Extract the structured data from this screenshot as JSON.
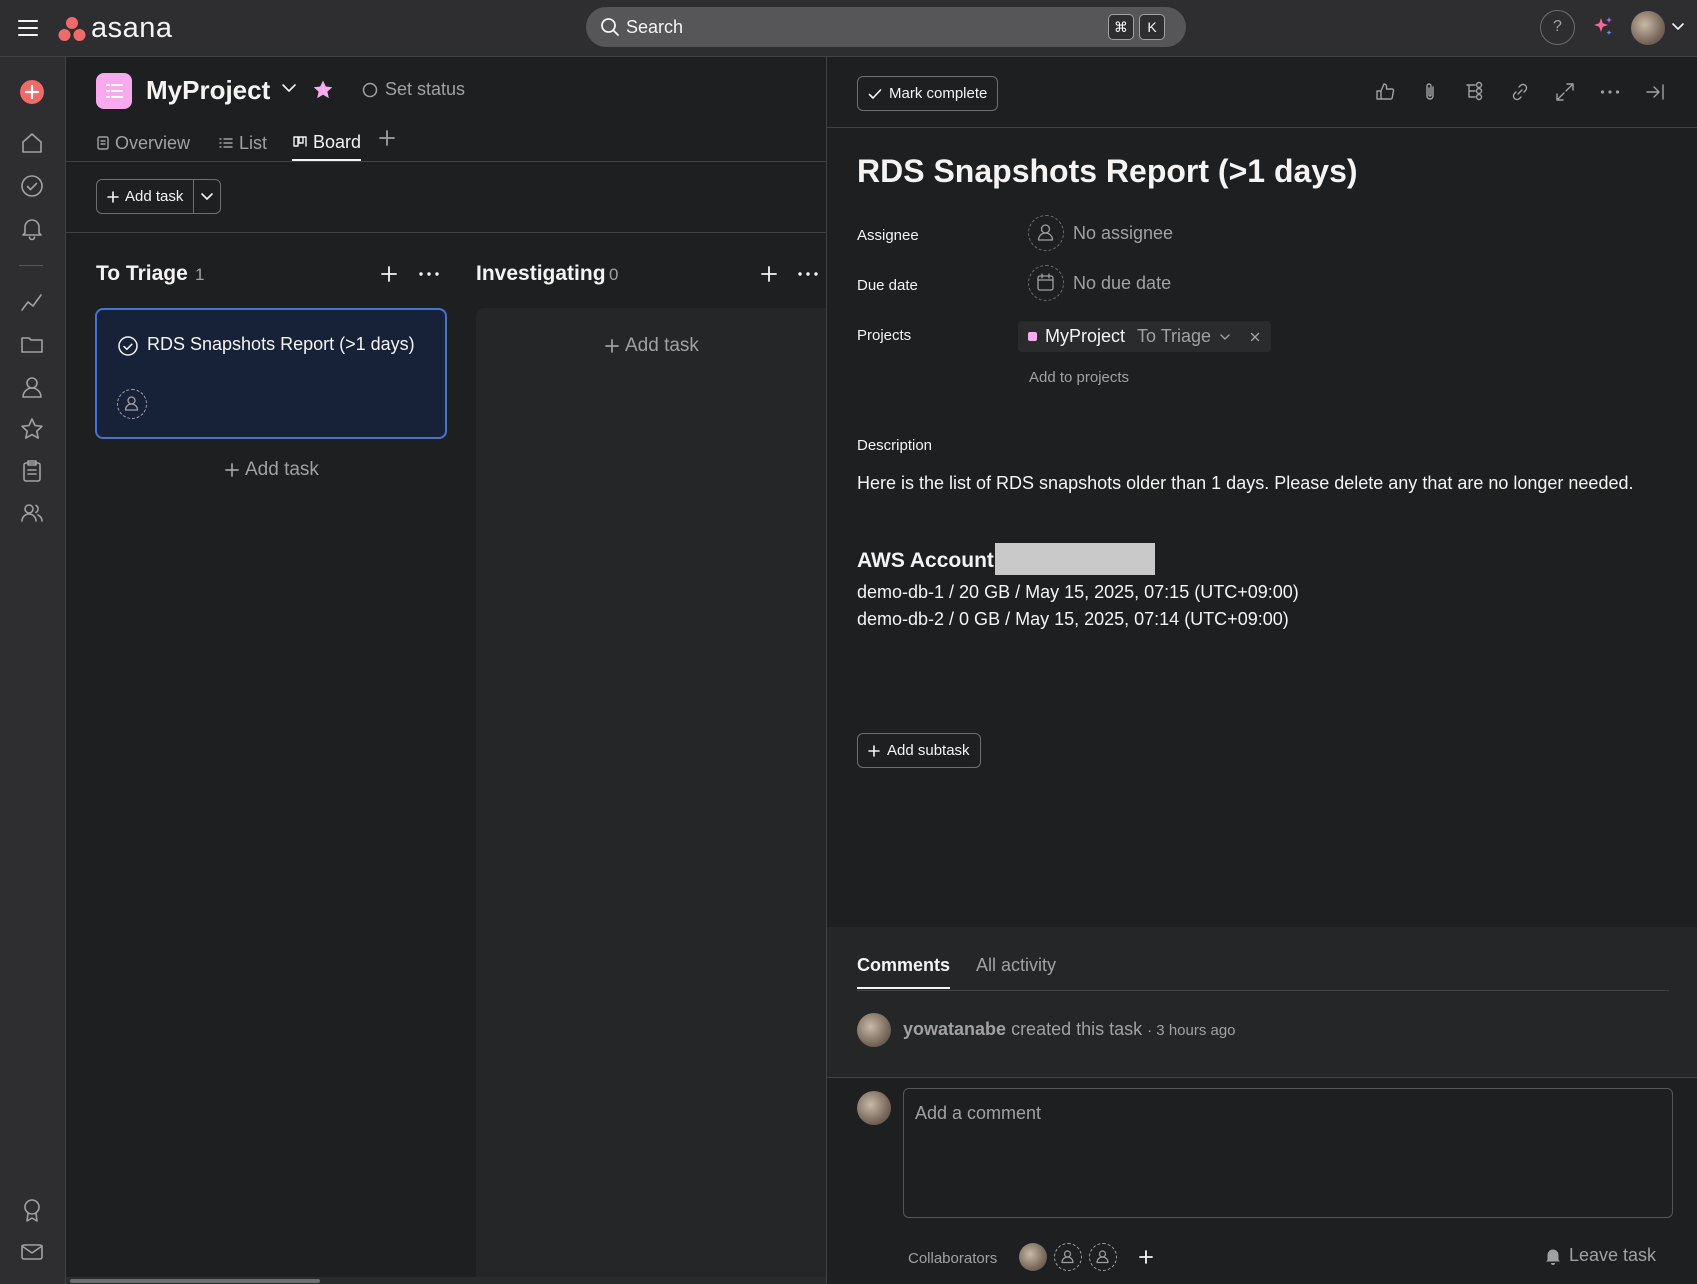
{
  "app": {
    "logo_text": "asana",
    "search_label": "Search",
    "search_keys": [
      "⌘",
      "K"
    ],
    "help_label": "?",
    "accent_color": "#f06a6a",
    "icons": {
      "menu": "hamburger-icon",
      "ai": "sparkle-icon",
      "rail": [
        "create-plus-icon",
        "home-icon",
        "my-tasks-icon",
        "inbox-bell-icon",
        "reporting-icon",
        "portfolios-folder-icon",
        "goals-person-icon",
        "favorites-star-icon",
        "projects-clipboard-icon",
        "teams-people-icon",
        "invite-badge-icon",
        "mail-icon"
      ]
    }
  },
  "project": {
    "name": "MyProject",
    "color": "#f9aaef",
    "set_status_label": "Set status",
    "tabs": [
      {
        "label": "Overview",
        "active": false
      },
      {
        "label": "List",
        "active": false
      },
      {
        "label": "Board",
        "active": true
      }
    ],
    "add_task_label": "Add task"
  },
  "board": {
    "columns": [
      {
        "title": "To Triage",
        "count": "1",
        "cards": [
          {
            "title": "RDS Snapshots Report (>1 days)"
          }
        ],
        "add_task_label": "Add task"
      },
      {
        "title": "Investigating",
        "count": "0",
        "cards": [],
        "add_task_label": "Add task"
      }
    ]
  },
  "task": {
    "mark_complete_label": "Mark complete",
    "title": "RDS Snapshots Report (>1 days)",
    "fields": {
      "assignee_label": "Assignee",
      "assignee_value": "No assignee",
      "due_label": "Due date",
      "due_value": "No due date",
      "projects_label": "Projects",
      "project_name": "MyProject",
      "project_section": "To Triage",
      "add_to_projects": "Add to projects"
    },
    "description_label": "Description",
    "description": {
      "intro": "Here is the list of RDS snapshots older than 1 days. Please delete any that are no longer needed.",
      "aws_account_label": "AWS Account:",
      "snapshots": [
        "demo-db-1 / 20 GB / May 15, 2025, 07:15 (UTC+09:00)",
        "demo-db-2 / 0 GB / May 15, 2025, 07:14 (UTC+09:00)"
      ]
    },
    "add_subtask_label": "Add subtask"
  },
  "activity": {
    "tabs": [
      {
        "label": "Comments",
        "active": true
      },
      {
        "label": "All activity",
        "active": false
      }
    ],
    "entries": [
      {
        "user": "yowatanabe",
        "action": "created this task",
        "time": "· 3 hours ago"
      }
    ],
    "comment_placeholder": "Add a comment",
    "collaborators_label": "Collaborators",
    "leave_task_label": "Leave task"
  }
}
